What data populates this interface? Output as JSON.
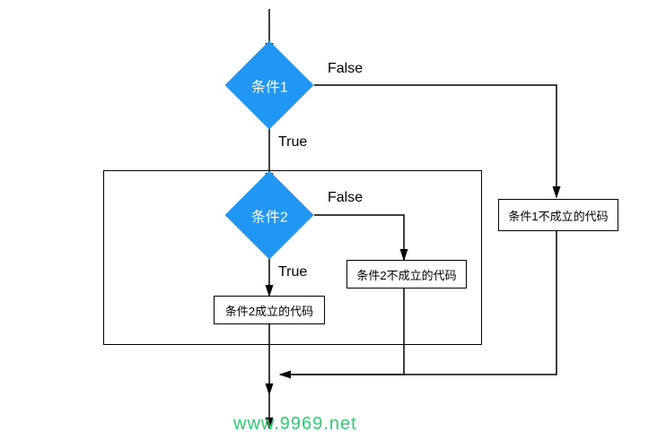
{
  "flowchart": {
    "nodes": {
      "condition1": {
        "label": "条件1",
        "type": "decision",
        "color": "#2196f3"
      },
      "condition2": {
        "label": "条件2",
        "type": "decision",
        "color": "#2196f3"
      },
      "code_cond2_true": {
        "label": "条件2成立的代码",
        "type": "process"
      },
      "code_cond2_false": {
        "label": "条件2不成立的代码",
        "type": "process"
      },
      "code_cond1_false": {
        "label": "条件1不成立的代码",
        "type": "process"
      }
    },
    "edges": {
      "cond1_true": "True",
      "cond1_false": "False",
      "cond2_true": "True",
      "cond2_false": "False"
    },
    "structure": "Nested if-else: 条件1 True branch contains nested 条件2 decision; 条件1 False branch runs 条件1不成立的代码. Inner 条件2 True runs 条件2成立的代码, False runs 条件2不成立的代码. All paths merge to single exit."
  },
  "watermark": "www.9969.net"
}
